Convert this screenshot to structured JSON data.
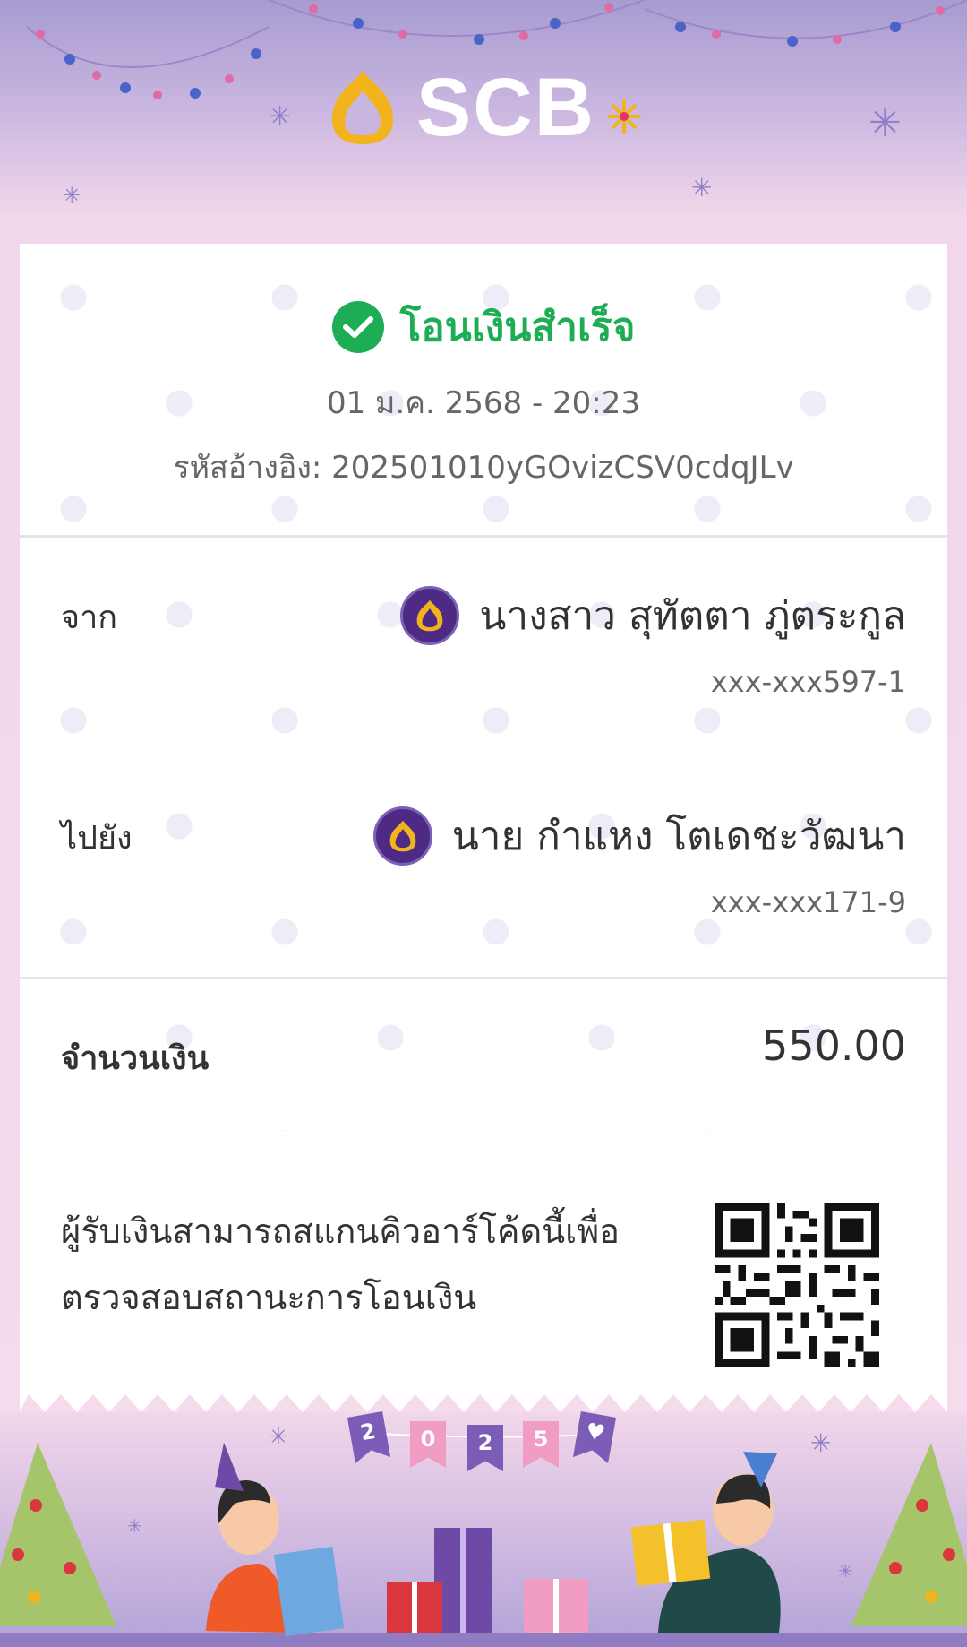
{
  "brand": {
    "name": "SCB",
    "colors": {
      "primary": "#4e2a84",
      "gold": "#f2b41c",
      "success": "#1dae55"
    }
  },
  "header": {
    "logo_text": "SCB",
    "icon": "scb-logo-icon"
  },
  "receipt": {
    "status": "โอนเงินสำเร็จ",
    "datetime": "01 ม.ค. 2568 - 20:23",
    "reference": "รหัสอ้างอิง: 202501010yGOvizCSV0cdqJLv",
    "from": {
      "label": "จาก",
      "name": "นางสาว สุทัตตา ภู่ตระกูล",
      "account": "xxx-xxx597-1"
    },
    "to": {
      "label": "ไปยัง",
      "name": "นาย กำแหง โตเดชะวัฒนา",
      "account": "xxx-xxx171-9"
    },
    "amount": {
      "label": "จำนวนเงิน",
      "value": "550.00"
    },
    "qr_note": {
      "line1": "ผู้รับเงินสามารถสแกนคิวอาร์โค้ดนี้เพื่อ",
      "line2": "ตรวจสอบสถานะการโอนเงิน"
    }
  },
  "footer": {
    "banner": [
      "2",
      "0",
      "2",
      "5",
      "♥"
    ]
  }
}
